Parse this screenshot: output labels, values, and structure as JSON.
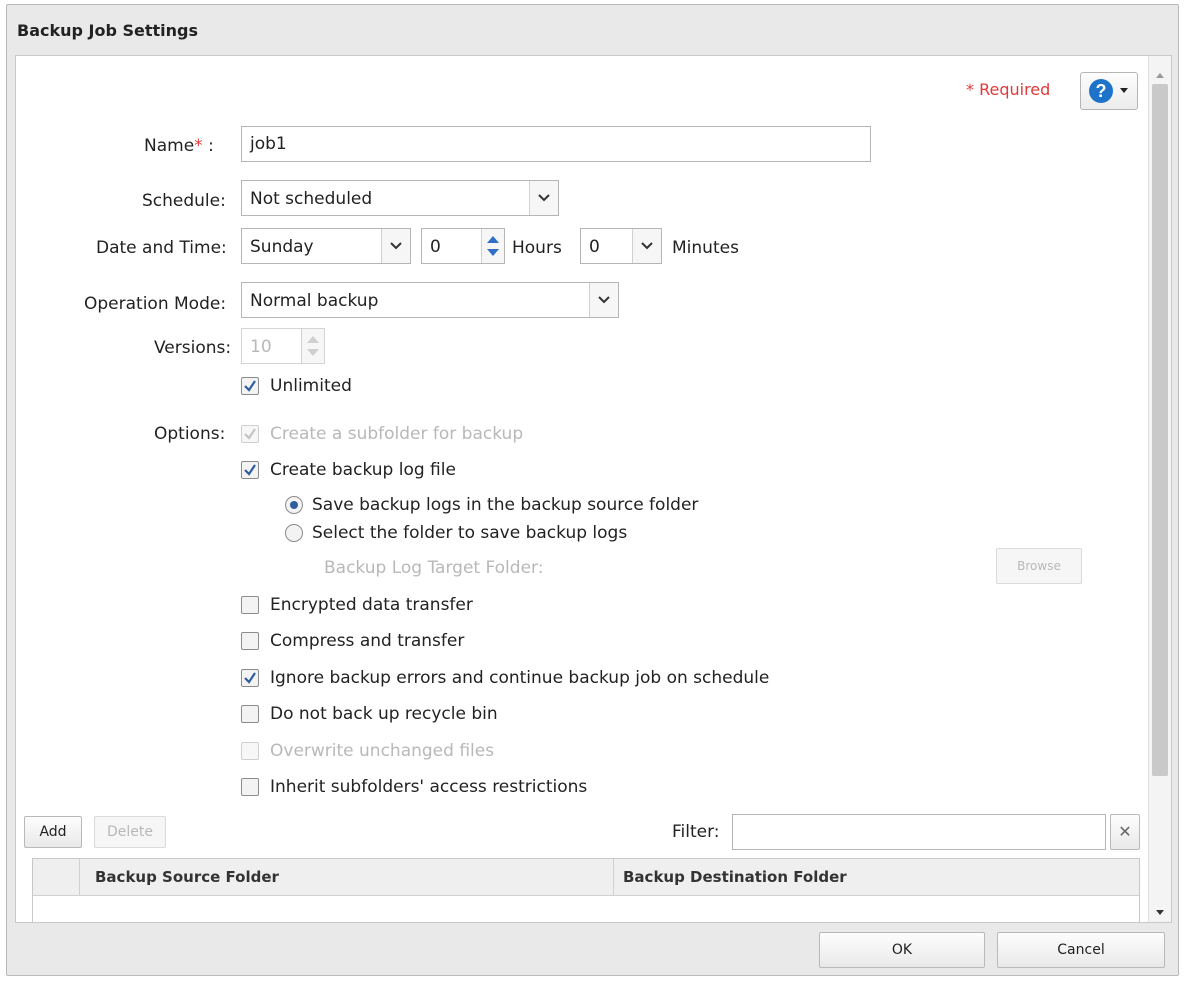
{
  "dialog": {
    "title": "Backup Job Settings",
    "required_note": "Required",
    "required_star": "*"
  },
  "form": {
    "name": {
      "label": "Name",
      "star": "*",
      "colon": ":",
      "value": "job1"
    },
    "schedule": {
      "label": "Schedule:",
      "value": "Not scheduled"
    },
    "date_time": {
      "label": "Date and Time:",
      "day": "Sunday",
      "hours_value": "0",
      "hours_label": "Hours",
      "minutes_value": "0",
      "minutes_label": "Minutes"
    },
    "operation_mode": {
      "label": "Operation Mode:",
      "value": "Normal backup"
    },
    "versions": {
      "label": "Versions:",
      "value": "10"
    },
    "unlimited": {
      "label": "Unlimited",
      "checked": true
    },
    "options": {
      "label": "Options:",
      "create_subfolder": {
        "label": "Create a subfolder for backup",
        "checked": true,
        "disabled": true
      },
      "create_log": {
        "label": "Create backup log file",
        "checked": true
      },
      "log_source": {
        "label": "Save backup logs in the backup source folder",
        "selected": true
      },
      "log_select": {
        "label": "Select the folder to save backup logs",
        "selected": false
      },
      "log_target_label": "Backup Log Target Folder:",
      "browse_label": "Browse",
      "encrypted": {
        "label": "Encrypted data transfer",
        "checked": false
      },
      "compress": {
        "label": "Compress and transfer",
        "checked": false
      },
      "ignore_errors": {
        "label": "Ignore backup errors and continue backup job on schedule",
        "checked": true
      },
      "no_recycle": {
        "label": "Do not back up recycle bin",
        "checked": false
      },
      "overwrite": {
        "label": "Overwrite unchanged files",
        "checked": false,
        "disabled": true
      },
      "inherit": {
        "label": "Inherit subfolders' access restrictions",
        "checked": false
      }
    }
  },
  "table_toolbar": {
    "add_label": "Add",
    "delete_label": "Delete",
    "filter_label": "Filter:",
    "filter_value": ""
  },
  "table": {
    "columns": [
      "Backup Source Folder",
      "Backup Destination Folder"
    ],
    "rows": []
  },
  "footer": {
    "ok_label": "OK",
    "cancel_label": "Cancel"
  },
  "colors": {
    "accent": "#1d73c9",
    "required": "#e23a3a"
  }
}
